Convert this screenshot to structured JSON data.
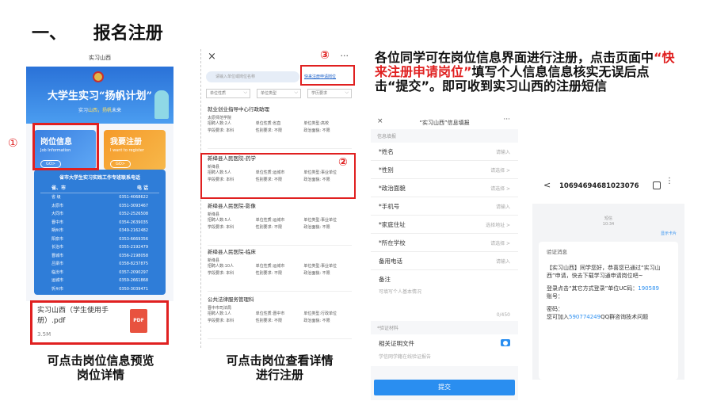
{
  "section": {
    "number": "一、",
    "title": "报名注册"
  },
  "phone1": {
    "app_title": "实习山西",
    "banner_title": "大学生实习“扬帆计划”",
    "banner_sub_pre": "实习",
    "banner_sub_hl": "山西，扬帆",
    "banner_sub_post": "未来",
    "card_job": {
      "title": "岗位信息",
      "sub": "Job Information",
      "go": "GO>"
    },
    "card_register": {
      "title": "我要注册",
      "sub": "I want to register",
      "go": "GO>"
    },
    "table_title": "省市大学生实习实践工作专班联系电话",
    "table_headers": [
      "省、市",
      "电 话"
    ],
    "table_rows": [
      [
        "省 级",
        "0351-4068622"
      ],
      [
        "太原市",
        "0351-3093467"
      ],
      [
        "大同市",
        "0352-2526508"
      ],
      [
        "晋中市",
        "0354-2639035"
      ],
      [
        "朔州市",
        "0349-2162482"
      ],
      [
        "阳泉市",
        "0353-6669356"
      ],
      [
        "长治市",
        "0355-2192479"
      ],
      [
        "晋城市",
        "0356-2198058"
      ],
      [
        "吕梁市",
        "0358-8237875"
      ],
      [
        "临汾市",
        "0357-2090297"
      ],
      [
        "运城市",
        "0359-2661868"
      ],
      [
        "忻州市",
        "0350-3039471"
      ]
    ],
    "file_name": "实习山西（学生使用手册）.pdf",
    "file_size": "3.5M",
    "pdf_label": "PDF",
    "marker": "①",
    "caption_line1": "可点击岗位信息预览",
    "caption_line2": "岗位详情"
  },
  "phone2": {
    "close": "×",
    "more": "···",
    "search_placeholder": "请输入单位或岗位名称",
    "register_link": "快来注册申请岗位",
    "filters": [
      "单位性质",
      "单位类型",
      "学历要求"
    ],
    "marker_top": "③",
    "marker_mid": "②",
    "items": [
      {
        "name": "就业创业指导中心行政助理",
        "org": "太原师范学院",
        "line1": [
          "招聘人数:2人",
          "单位性质:省直",
          "单位类型:高校"
        ],
        "line2": [
          "学段要求: 本科",
          "性别要求: 不限",
          "政治面貌: 不限"
        ]
      },
      {
        "name": "新绛县人民医院-药学",
        "org": "新绛县",
        "line1": [
          "招聘人数:5人",
          "单位性质:运城市",
          "单位类型:事业单位"
        ],
        "line2": [
          "学段要求: 本科",
          "性别要求: 不限",
          "政治面貌: 不限"
        ]
      },
      {
        "name": "新绛县人民医院-影像",
        "org": "新绛县",
        "line1": [
          "招聘人数:5人",
          "单位性质:运城市",
          "单位类型:事业单位"
        ],
        "line2": [
          "学段要求: 本科",
          "性别要求: 不限",
          "政治面貌: 不限"
        ]
      },
      {
        "name": "新绛县人民医院-临床",
        "org": "新绛县",
        "line1": [
          "招聘人数:10人",
          "单位性质:运城市",
          "单位类型:事业单位"
        ],
        "line2": [
          "学段要求: 本科",
          "性别要求: 不限",
          "政治面貌: 不限"
        ]
      },
      {
        "name": "公共法律服务管理科",
        "org": "晋中市司法局",
        "line1": [
          "招聘人数:1人",
          "单位性质:晋中市",
          "单位类型:行政单位"
        ],
        "line2": [
          "学段要求: 本科",
          "性别要求: 不限",
          "政治面貌: 不限"
        ]
      }
    ],
    "caption_line1": "可点击岗位查看详情",
    "caption_line2": "进行注册"
  },
  "instruction": {
    "part1": "各位同学可在岗位信息界面进行注册，点击页面中",
    "highlight": "“快来注册申请岗位”",
    "part2": "填写个人信息信息核实无误后点击“提交”。即可收到实习山西的注册短信"
  },
  "phone3": {
    "close": "×",
    "title": "“实习山西”信息填报",
    "more": "···",
    "group_label": "信息填报",
    "fields": [
      {
        "label": "*姓名",
        "value": "请输入"
      },
      {
        "label": "*性别",
        "value": "请选择 >"
      },
      {
        "label": "*政治面貌",
        "value": "请选择 >"
      },
      {
        "label": "*手机号",
        "value": "请输入"
      },
      {
        "label": "*家庭住址",
        "value": "选择地址 >"
      },
      {
        "label": "*所在学校",
        "value": "请选择 >"
      },
      {
        "label": "备用电话",
        "value": "请输入"
      }
    ],
    "note_label": "备注",
    "note_placeholder": "可填写个人基本情况",
    "note_counter": "0/450",
    "group2_label": "*验证材料",
    "upload_label": "相关证明文件",
    "upload_placeholder": "学信网学籍在线验证报告",
    "submit": "提交"
  },
  "phone4": {
    "back": "<",
    "sender": "10694694681023076",
    "more": "⋮",
    "time_line1": "短信",
    "time_line2": "10:34",
    "card_link": "显示卡片",
    "msg_title": "验证消息",
    "msg_p1": "【实习山西】同学您好，恭喜您已通过“实习山西”申请，快去下载学习通申请岗位吧~",
    "msg_p2_pre": "登录点击“其它方式登录”单位UC码：",
    "msg_uc": "190589",
    "msg_p2_post": "账号：",
    "msg_p3_pre": "密码：\n您可加入",
    "msg_qq": "590774249",
    "msg_p3_post": "QQ群咨询技术问题"
  }
}
